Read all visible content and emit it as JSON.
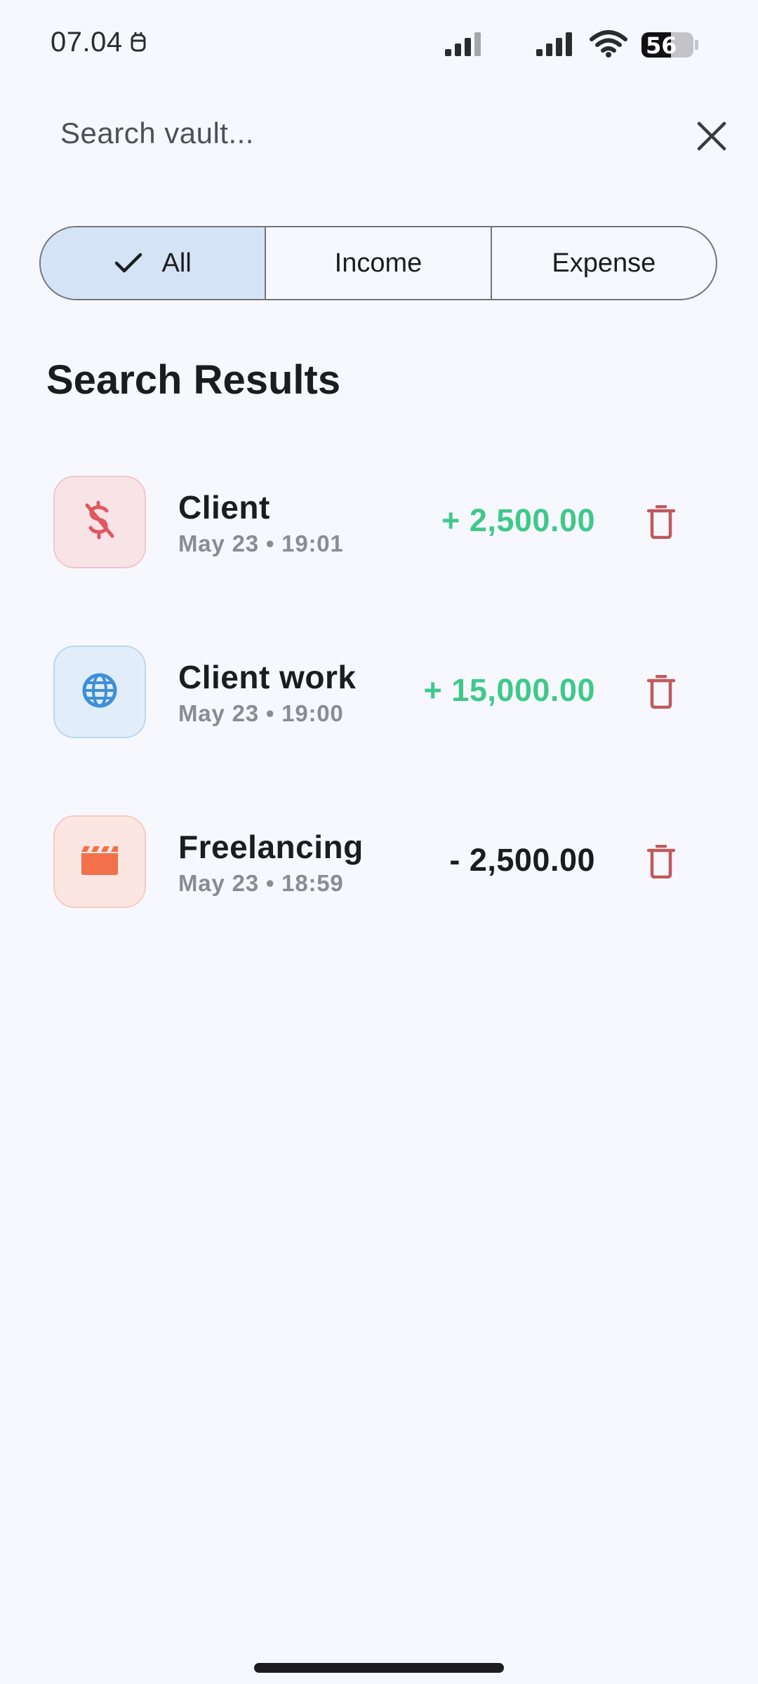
{
  "status_bar": {
    "time": "07.04",
    "battery_level": "56",
    "icons": [
      "notification-icon",
      "signal-icon",
      "signal-icon",
      "wifi-icon",
      "battery-icon"
    ]
  },
  "search": {
    "placeholder": "Search vault...",
    "value": ""
  },
  "filter": {
    "options": [
      "All",
      "Income",
      "Expense"
    ],
    "selected": "All"
  },
  "section_title": "Search Results",
  "results": [
    {
      "title": "Client",
      "subtitle": "May 23 • 19:01",
      "amount": "+ 2,500.00",
      "type": "income",
      "icon": "dollar-off-icon",
      "icon_color": "#e0565f"
    },
    {
      "title": "Client work",
      "subtitle": "May 23 • 19:00",
      "amount": "+ 15,000.00",
      "type": "income",
      "icon": "globe-icon",
      "icon_color": "#3f8fd8"
    },
    {
      "title": "Freelancing",
      "subtitle": "May 23 • 18:59",
      "amount": "- 2,500.00",
      "type": "expense",
      "icon": "clapperboard-icon",
      "icon_color": "#f2704a"
    }
  ],
  "colors": {
    "income": "#3ec98a",
    "delete": "#c2585c",
    "selected_segment": "#d5e3f6"
  }
}
